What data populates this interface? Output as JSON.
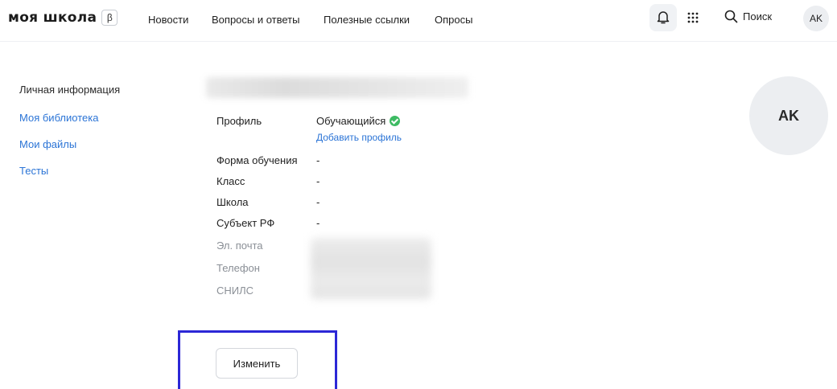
{
  "header": {
    "logo_text": "моя школа",
    "logo_badge": "β",
    "nav": [
      "Новости",
      "Вопросы и ответы",
      "Полезные ссылки",
      "Опросы"
    ],
    "search_label": "Поиск",
    "avatar_initials": "AK"
  },
  "sidebar": {
    "items": [
      {
        "label": "Личная информация"
      },
      {
        "label": "Моя библиотека"
      },
      {
        "label": "Мои файлы"
      },
      {
        "label": "Тесты"
      }
    ]
  },
  "profile": {
    "rows": [
      {
        "label": "Профиль",
        "value": "Обучающийся"
      },
      {
        "label": "Форма обучения",
        "value": "-"
      },
      {
        "label": "Класс",
        "value": "-"
      },
      {
        "label": "Школа",
        "value": "-"
      },
      {
        "label": "Субъект РФ",
        "value": "-"
      }
    ],
    "add_profile": "Добавить профиль",
    "contact_labels": [
      "Эл. почта",
      "Телефон",
      "СНИЛС"
    ],
    "avatar_initials": "AK",
    "edit_button": "Изменить"
  },
  "colors": {
    "link": "#2b74d6",
    "highlight": "#2c27d6",
    "success": "#3dbb63"
  }
}
